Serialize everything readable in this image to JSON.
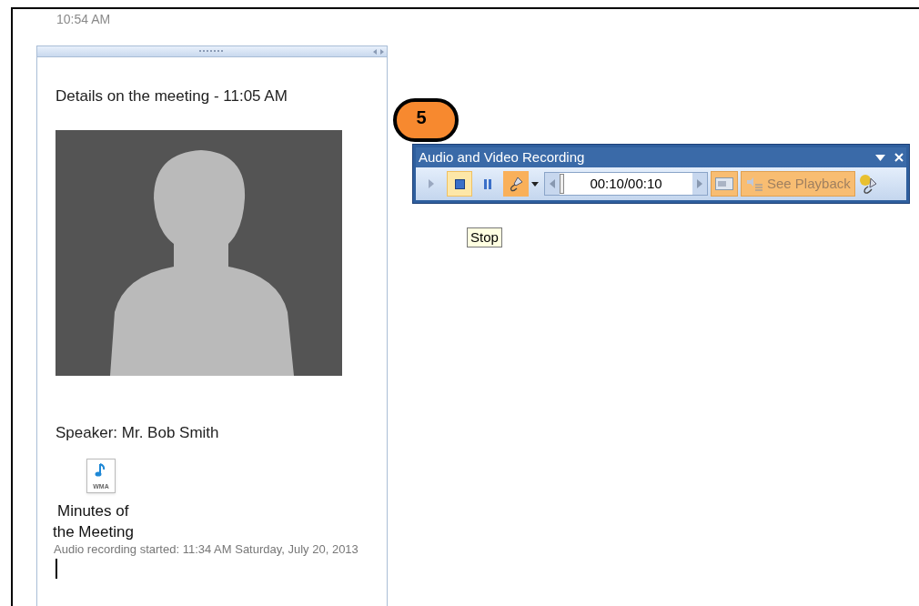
{
  "timestamp": "10:54 AM",
  "note": {
    "title": "Details on the meeting - 11:05 AM",
    "speaker": "Speaker: Mr. Bob Smith",
    "attachment": {
      "badge": "WMA",
      "name_lines": [
        "Minutes of",
        "the Meeting"
      ]
    },
    "recording_info": "Audio recording started: 11:34 AM Saturday, July 20, 2013"
  },
  "step_badge": "5",
  "toolbar": {
    "title": "Audio and Video Recording",
    "buttons": [
      {
        "kind": "play",
        "highlighted": false,
        "pressed": false
      },
      {
        "kind": "stop",
        "highlighted": true,
        "pressed": false
      },
      {
        "kind": "pause",
        "highlighted": false,
        "pressed": false
      },
      {
        "kind": "record",
        "highlighted": false,
        "pressed": true
      }
    ],
    "time": "00:10/00:10",
    "level": 0,
    "playback": "See Playback"
  },
  "tooltip": "Stop"
}
